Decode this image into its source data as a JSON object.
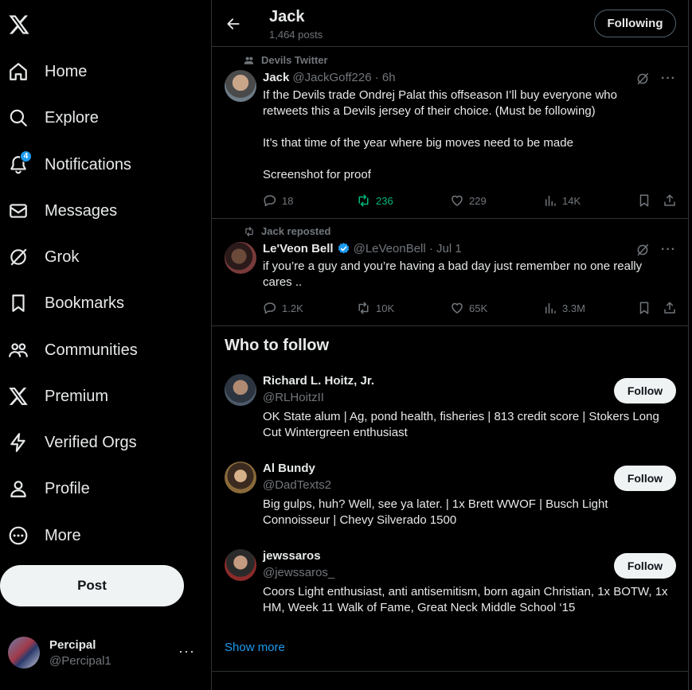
{
  "nav": {
    "logo": "x-logo",
    "items": [
      {
        "label": "Home",
        "icon": "home-icon"
      },
      {
        "label": "Explore",
        "icon": "search-icon"
      },
      {
        "label": "Notifications",
        "icon": "bell-icon",
        "badge": "4"
      },
      {
        "label": "Messages",
        "icon": "envelope-icon"
      },
      {
        "label": "Grok",
        "icon": "grok-icon"
      },
      {
        "label": "Bookmarks",
        "icon": "bookmark-icon"
      },
      {
        "label": "Communities",
        "icon": "communities-icon"
      },
      {
        "label": "Premium",
        "icon": "x-icon"
      },
      {
        "label": "Verified Orgs",
        "icon": "lightning-icon"
      },
      {
        "label": "Profile",
        "icon": "person-icon"
      },
      {
        "label": "More",
        "icon": "more-circle-icon"
      }
    ],
    "post_label": "Post",
    "account": {
      "name": "Percipal",
      "handle": "@Percipal1",
      "more": "···"
    }
  },
  "header": {
    "title": "Jack",
    "posts_count": "1,464 posts",
    "following_label": "Following"
  },
  "tweets": [
    {
      "context": "Devils Twitter",
      "name": "Jack",
      "meta": "@JackGoff226 · 6h",
      "text": "If the Devils trade Ondrej Palat this offseason I’ll buy everyone who retweets this a Devils jersey of their choice. (Must be following)\n\nIt’s that time of the year where big moves need to be made\n\nScreenshot for proof",
      "replies": "18",
      "reposts": "236",
      "likes": "229",
      "views": "14K"
    },
    {
      "context": "Jack reposted",
      "name": "Le'Veon Bell",
      "meta": "@LeVeonBell · Jul 1",
      "text": "if you’re a guy and you’re having a bad day just remember no one really cares ..",
      "replies": "1.2K",
      "reposts": "10K",
      "likes": "65K",
      "views": "3.3M"
    }
  ],
  "who_to_follow": {
    "title": "Who to follow",
    "follow_label": "Follow",
    "suggestions": [
      {
        "name": "Richard L. Hoitz, Jr.",
        "handle": "@RLHoitzII",
        "bio": "OK State alum | Ag, pond health, fisheries | 813 credit score | Stokers Long Cut Wintergreen enthusiast"
      },
      {
        "name": "Al Bundy",
        "handle": "@DadTexts2",
        "bio": "Big gulps, huh? Well, see ya later. | 1x Brett WWOF | Busch Light Connoisseur | Chevy Silverado 1500"
      },
      {
        "name": "jewssaros",
        "handle": "@jewssaros_",
        "bio": "Coors Light enthusiast, anti antisemitism, born again Christian, 1x BOTW, 1x HM, Week 11 Walk of Fame, Great Neck Middle School ‘15"
      }
    ],
    "show_more": "Show more"
  },
  "colors": {
    "accent": "#1d9bf0",
    "repost_green": "#00ba7c",
    "muted": "#71767b",
    "border": "#2f3336"
  }
}
